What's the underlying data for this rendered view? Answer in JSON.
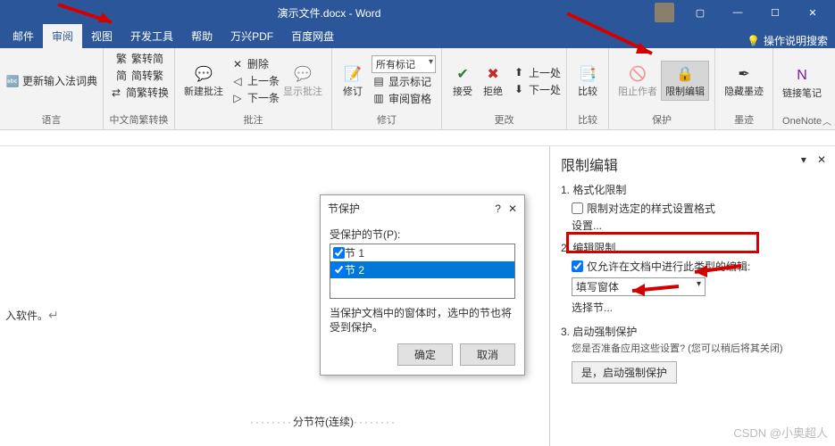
{
  "title": "演示文件.docx - Word",
  "tabs": [
    "邮件",
    "审阅",
    "视图",
    "开发工具",
    "帮助",
    "万兴PDF",
    "百度网盘"
  ],
  "active_tab_index": 1,
  "help_hint": "操作说明搜索",
  "ribbon": {
    "lang": {
      "update": "更新输入法词典",
      "label": "语言"
    },
    "zhconv": {
      "a": "繁转简",
      "b": "简转繁",
      "c": "简繁转换",
      "label": "中文简繁转换"
    },
    "comments": {
      "new": "新建批注",
      "del": "删除",
      "show": "显示批注",
      "prev": "上一条",
      "next": "下一条",
      "label": "批注"
    },
    "track": {
      "btn": "修订",
      "dd": "所有标记",
      "show": "显示标记",
      "pane": "审阅窗格",
      "label": "修订"
    },
    "changes": {
      "accept": "接受",
      "reject": "拒绝",
      "prev": "上一处",
      "next": "下一处",
      "label": "更改"
    },
    "compare": {
      "btn": "比较",
      "label": "比较"
    },
    "protect": {
      "block": "阻止作者",
      "restrict": "限制编辑",
      "label": "保护"
    },
    "ink": {
      "hide": "隐藏墨迹",
      "label": "墨迹"
    },
    "onenote": {
      "link": "链接笔记",
      "label": "OneNote"
    }
  },
  "doc": {
    "text": "入软件。",
    "section_break": "分节符(连续)"
  },
  "dialog": {
    "title": "节保护",
    "label": "受保护的节(P):",
    "items": [
      "节 1",
      "节 2"
    ],
    "checked": [
      true,
      true
    ],
    "selected_index": 1,
    "msg": "当保护文档中的窗体时，选中的节也将受到保护。",
    "ok": "确定",
    "cancel": "取消"
  },
  "panel": {
    "title": "限制编辑",
    "s1": "1. 格式化限制",
    "s1_chk": "限制对选定的样式设置格式",
    "settings": "设置...",
    "s2": "2. 编辑限制",
    "s2_chk": "仅允许在文档中进行此类型的编辑:",
    "s2_sel": "填写窗体",
    "s2_link": "选择节...",
    "s3": "3. 启动强制保护",
    "s3_msg": "您是否准备应用这些设置? (您可以稍后将其关闭)",
    "s3_btn": "是，启动强制保护"
  },
  "watermark": "CSDN @小奥超人"
}
